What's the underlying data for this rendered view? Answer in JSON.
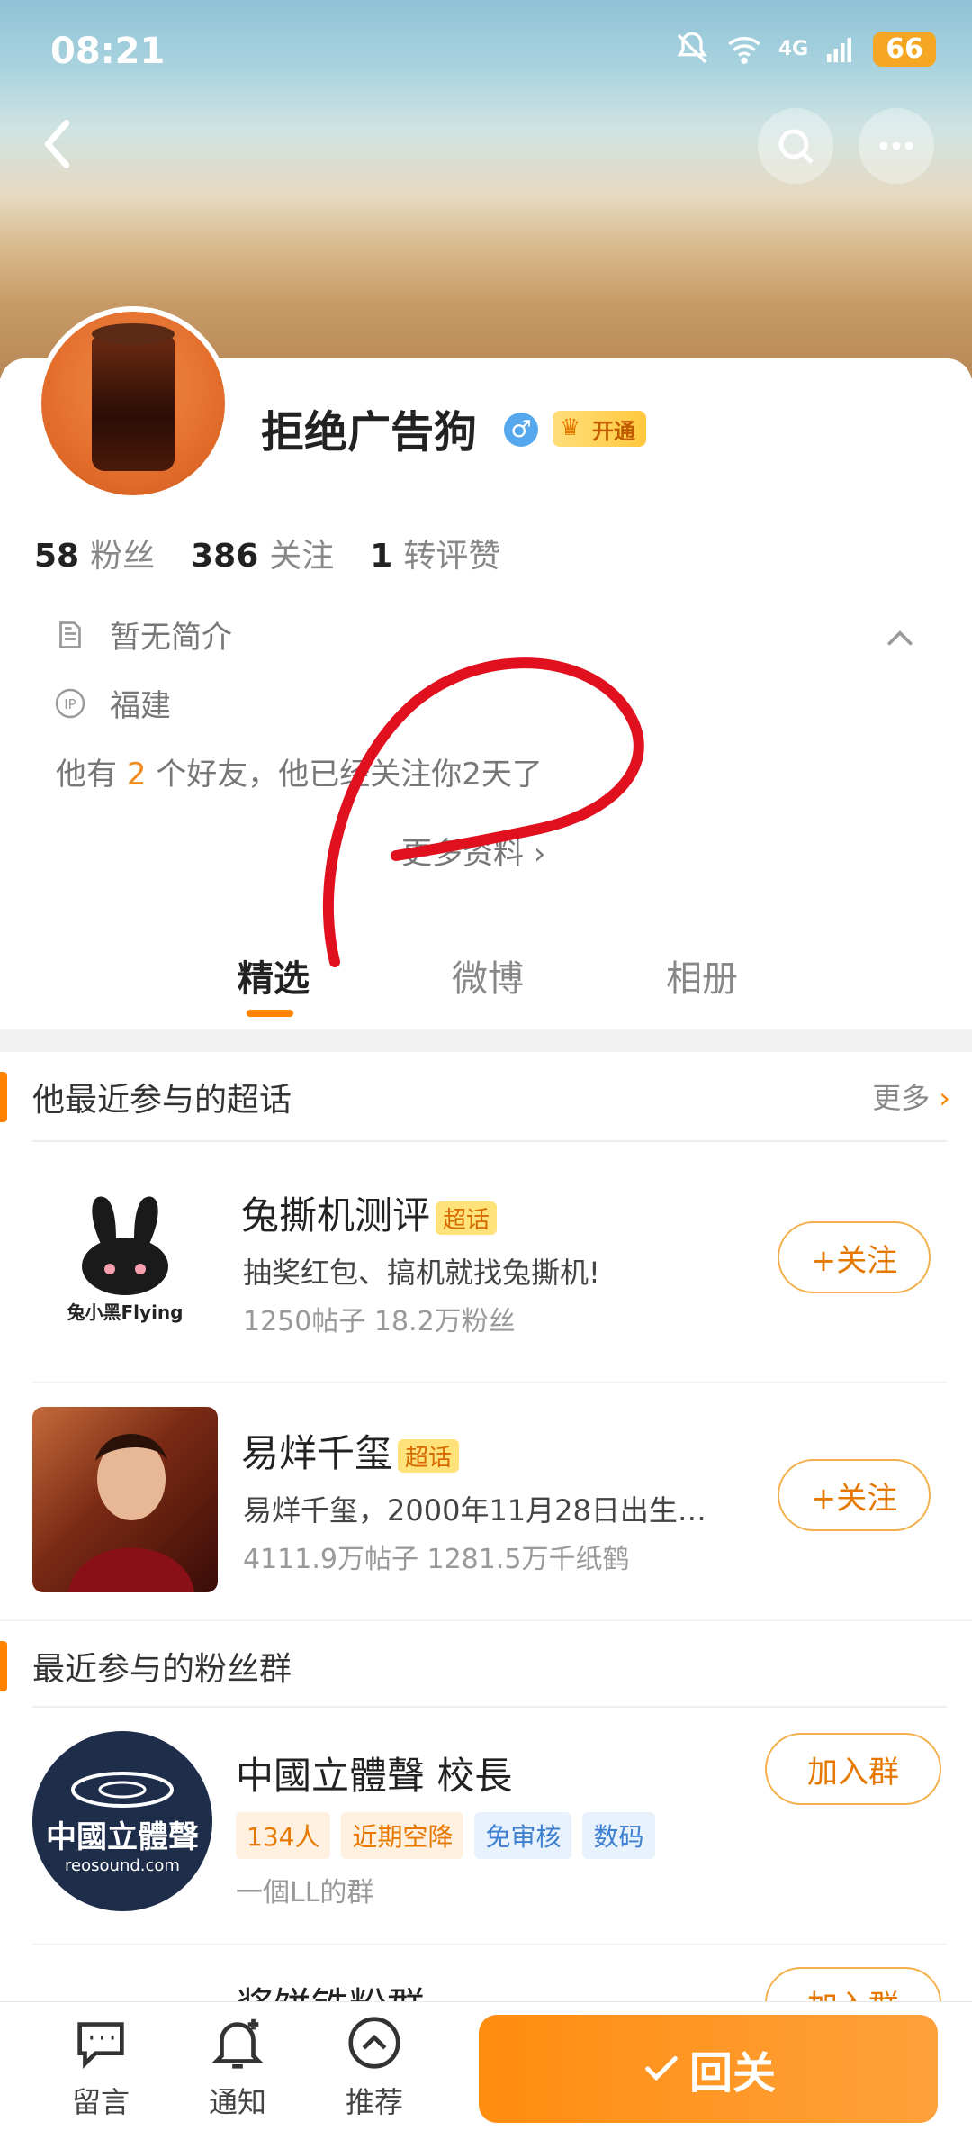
{
  "status_bar": {
    "time": "08:21",
    "network": "4G",
    "battery": "66"
  },
  "profile": {
    "name": "拒绝广告狗",
    "gender_icon": "male-icon",
    "vip_label": "开通",
    "stats": [
      {
        "value": "58",
        "label": "粉丝"
      },
      {
        "value": "386",
        "label": "关注"
      },
      {
        "value": "1",
        "label": "转评赞"
      }
    ],
    "bio": "暂无简介",
    "ip_location": "福建",
    "friends_prefix": "他有",
    "friends_count": "2",
    "friends_suffix": "个好友，他已经关注你2天了",
    "more_info": "更多资料"
  },
  "tabs": [
    {
      "label": "精选",
      "active": true
    },
    {
      "label": "微博",
      "active": false
    },
    {
      "label": "相册",
      "active": false
    }
  ],
  "supertopics": {
    "title": "他最近参与的超话",
    "more": "更多",
    "items": [
      {
        "title": "兔撕机测评",
        "tag": "超话",
        "desc": "抽奖红包、搞机就找兔撕机!",
        "meta": "1250帖子 18.2万粉丝",
        "button": "+关注",
        "thumb_text": "兔小黑Flying"
      },
      {
        "title": "易烊千玺",
        "tag": "超话",
        "desc": "易烊千玺，2000年11月28日出生…",
        "meta": "4111.9万帖子 1281.5万千纸鹤",
        "button": "+关注"
      }
    ]
  },
  "fan_groups": {
    "title": "最近参与的粉丝群",
    "items": [
      {
        "title": "中國立體聲 校長",
        "chips": [
          "134人",
          "近期空降",
          "免审核",
          "数码"
        ],
        "desc": "一個LL的群",
        "button": "加入群",
        "logo_text": "中國立體聲",
        "logo_sub": "reosound.com"
      },
      {
        "title": "浆饼铁粉群",
        "button": "加入群"
      }
    ]
  },
  "bottom_bar": {
    "items": [
      {
        "label": "留言",
        "icon": "message-icon"
      },
      {
        "label": "通知",
        "icon": "bell-plus-icon"
      },
      {
        "label": "推荐",
        "icon": "recommend-icon"
      }
    ],
    "reply_label": "回关"
  },
  "colors": {
    "accent": "#ff8200",
    "link_orange": "#f08a1c",
    "chip_orange_bg": "#fff0e0",
    "chip_blue_bg": "#e8f2fd"
  }
}
